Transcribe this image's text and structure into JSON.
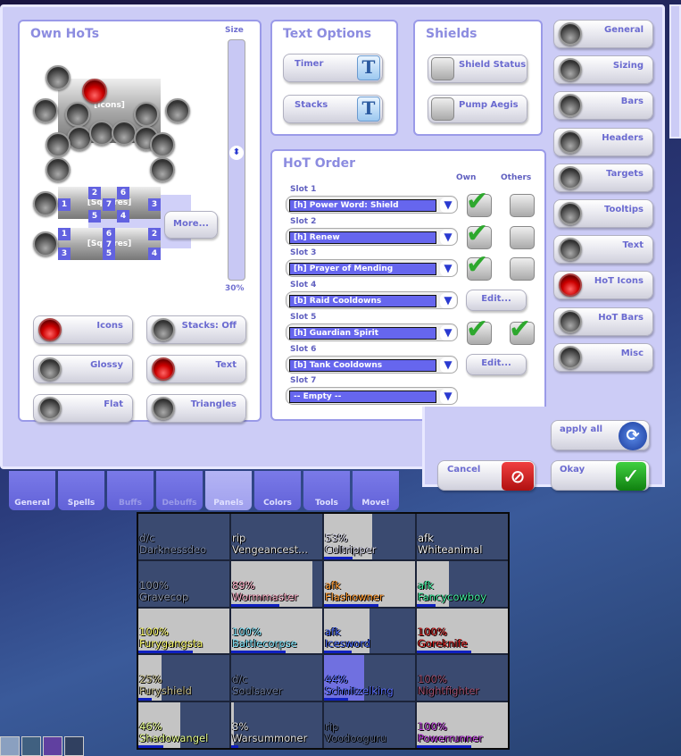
{
  "own_hots": {
    "title": "Own HoTs",
    "size_label": "Size",
    "size_value": "30%",
    "icons_label": "[Icons]",
    "squares_label": "[Squares]",
    "more_button": "More...",
    "squares1_nums": [
      "1",
      "2",
      "6",
      "7",
      "3",
      "5",
      "4"
    ],
    "squares2_nums": [
      "1",
      "6",
      "2",
      "7",
      "3",
      "5",
      "4"
    ],
    "toggles": [
      {
        "label": "Icons",
        "on": true
      },
      {
        "label": "Stacks: Off",
        "on": false
      },
      {
        "label": "Glossy",
        "on": false
      },
      {
        "label": "Text",
        "on": true
      },
      {
        "label": "Flat",
        "on": false
      },
      {
        "label": "Triangles",
        "on": false
      }
    ]
  },
  "text_options": {
    "title": "Text Options",
    "timer": "Timer",
    "stacks": "Stacks",
    "icon_glyph": "T"
  },
  "shields": {
    "title": "Shields",
    "status": "Shield Status",
    "pump": "Pump Aegis"
  },
  "hot_order": {
    "title": "HoT Order",
    "own_header": "Own",
    "others_header": "Others",
    "edit_label": "Edit...",
    "slots": [
      {
        "label": "Slot 1",
        "value": "[h] Power Word: Shield",
        "type": "check",
        "own": true,
        "others": false
      },
      {
        "label": "Slot 2",
        "value": "[h] Renew",
        "type": "check",
        "own": true,
        "others": false
      },
      {
        "label": "Slot 3",
        "value": "[h] Prayer of Mending",
        "type": "check",
        "own": true,
        "others": false
      },
      {
        "label": "Slot 4",
        "value": "[b] Raid Cooldowns",
        "type": "edit"
      },
      {
        "label": "Slot 5",
        "value": "[h] Guardian Spirit",
        "type": "check",
        "own": true,
        "others": true
      },
      {
        "label": "Slot 6",
        "value": "[b] Tank Cooldowns",
        "type": "edit"
      },
      {
        "label": "Slot 7",
        "value": "-- Empty --",
        "type": "none"
      }
    ]
  },
  "categories": [
    {
      "label": "General",
      "on": false
    },
    {
      "label": "Sizing",
      "on": false
    },
    {
      "label": "Bars",
      "on": false
    },
    {
      "label": "Headers",
      "on": false
    },
    {
      "label": "Targets",
      "on": false
    },
    {
      "label": "Tooltips",
      "on": false
    },
    {
      "label": "Text",
      "on": false
    },
    {
      "label": "HoT Icons",
      "on": true
    },
    {
      "label": "HoT Bars",
      "on": false
    },
    {
      "label": "Misc",
      "on": false
    }
  ],
  "actions": {
    "apply_all": "apply all",
    "cancel": "Cancel",
    "okay": "Okay"
  },
  "tabs": [
    {
      "label": "General",
      "state": "normal"
    },
    {
      "label": "Spells",
      "state": "normal"
    },
    {
      "label": "Buffs",
      "state": "dim"
    },
    {
      "label": "Debuffs",
      "state": "dim"
    },
    {
      "label": "Panels",
      "state": "active"
    },
    {
      "label": "Colors",
      "state": "normal"
    },
    {
      "label": "Tools",
      "state": "normal"
    },
    {
      "label": "Move!",
      "state": "normal"
    }
  ],
  "raid_frames": [
    {
      "status": "d/c",
      "name": "Darknessdeo",
      "health": 0,
      "color": "#7a88a8"
    },
    {
      "status": "rip",
      "name": "Vengeancest...",
      "health": 0,
      "color": "#e0e0e0"
    },
    {
      "status": "53%",
      "name": "Cultripper",
      "health": 53,
      "color": "#dcdcf0"
    },
    {
      "status": "afk",
      "name": "Whiteanimal",
      "health": 0,
      "color": "#f0f0f0"
    },
    {
      "status": "100%",
      "name": "Gravecop",
      "health": 0,
      "color": "#8a94aa"
    },
    {
      "status": "89%",
      "name": "Wormmaster",
      "health": 89,
      "color": "#ffb0c8"
    },
    {
      "status": "afk",
      "name": "Flashowner",
      "health": 100,
      "color": "#ff9a30"
    },
    {
      "status": "afk",
      "name": "Fancycowboy",
      "health": 35,
      "color": "#40f0a0"
    },
    {
      "status": "100%",
      "name": "Furygangsta",
      "health": 100,
      "color": "#ffff70"
    },
    {
      "status": "100%",
      "name": "Battlecorpse",
      "health": 100,
      "color": "#80e8ff"
    },
    {
      "status": "afk",
      "name": "Icesword",
      "health": 50,
      "color": "#4060f0"
    },
    {
      "status": "100%",
      "name": "Goreknife",
      "health": 100,
      "color": "#d02020"
    },
    {
      "status": "25%",
      "name": "Furyshield",
      "health": 25,
      "color": "#c8c090"
    },
    {
      "status": "d/c",
      "name": "Soulsaver",
      "health": 0,
      "color": "#6a7898"
    },
    {
      "status": "44%",
      "name": "Schnitzelking",
      "health": 44,
      "color": "#5a70ff"
    },
    {
      "status": "100%",
      "name": "Nightfighter",
      "health": 0,
      "color": "#a05070"
    },
    {
      "status": "46%",
      "name": "Shadowangel",
      "health": 46,
      "color": "#e8ff90"
    },
    {
      "status": "3%",
      "name": "Warsummoner",
      "health": 3,
      "color": "#e0e0e0"
    },
    {
      "status": "rip",
      "name": "Voodooguru",
      "health": 0,
      "color": "#5a6888"
    },
    {
      "status": "100%",
      "name": "Powerrunner",
      "health": 100,
      "color": "#c040e0"
    }
  ]
}
